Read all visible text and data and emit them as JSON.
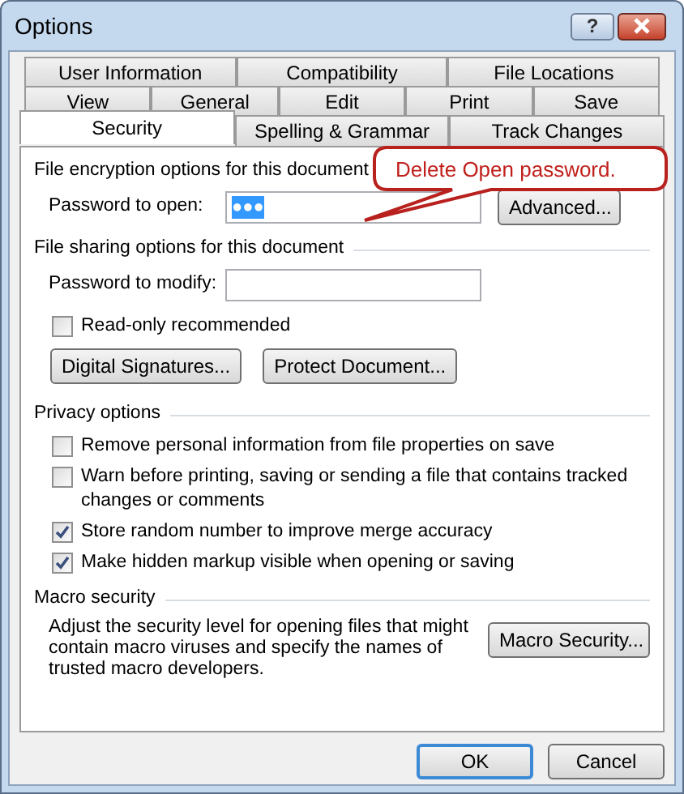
{
  "window": {
    "title": "Options",
    "help_button": "?"
  },
  "tab_rows": [
    [
      {
        "label": "User Information",
        "selected": false
      },
      {
        "label": "Compatibility",
        "selected": false
      },
      {
        "label": "File Locations",
        "selected": false
      }
    ],
    [
      {
        "label": "View",
        "selected": false
      },
      {
        "label": "General",
        "selected": false
      },
      {
        "label": "Edit",
        "selected": false
      },
      {
        "label": "Print",
        "selected": false
      },
      {
        "label": "Save",
        "selected": false
      }
    ],
    [
      {
        "label": "Security",
        "selected": true
      },
      {
        "label": "Spelling & Grammar",
        "selected": false
      },
      {
        "label": "Track Changes",
        "selected": false
      }
    ]
  ],
  "encryption": {
    "heading": "File encryption options for this document",
    "password_label": "Password to open:",
    "password_value": "●●●",
    "value_selected": true,
    "button": "Advanced..."
  },
  "callout": {
    "text": "Delete Open password."
  },
  "sharing": {
    "heading": "File sharing options for this document",
    "password_label": "Password to modify:",
    "read_only": {
      "label": "Read-only recommended",
      "checked": false
    },
    "buttons": [
      "Digital Signatures...",
      "Protect Document..."
    ]
  },
  "privacy": {
    "heading": "Privacy options",
    "options": [
      {
        "label": "Remove personal information from file properties on save",
        "checked": false
      },
      {
        "label": "Warn before printing, saving or sending a file that contains tracked changes or comments",
        "checked": false
      },
      {
        "label": "Store random number to improve merge accuracy",
        "checked": true
      },
      {
        "label": "Make hidden markup visible when opening or saving",
        "checked": true
      }
    ]
  },
  "macro": {
    "heading": "Macro security",
    "description": "Adjust the security level for opening files that might contain macro viruses and specify the names of trusted macro developers.",
    "button": "Macro Security..."
  },
  "buttons": [
    {
      "label": "OK",
      "default": true
    },
    {
      "label": "Cancel",
      "default": false
    }
  ]
}
